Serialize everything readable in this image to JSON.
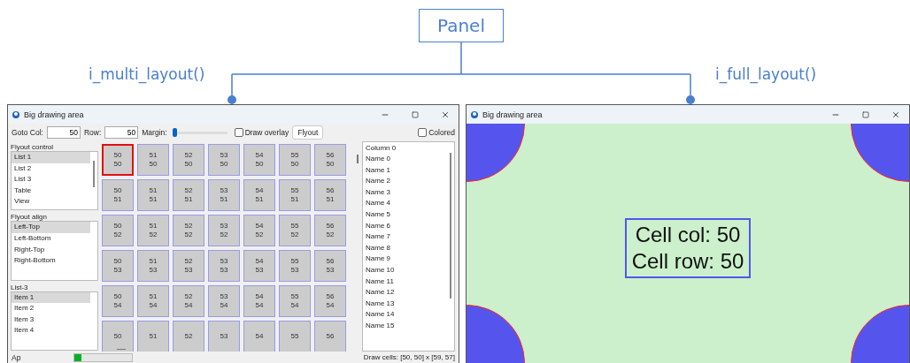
{
  "diagram": {
    "root": "Panel",
    "branches": [
      {
        "label": "i_multi_layout()"
      },
      {
        "label": "i_full_layout()"
      }
    ]
  },
  "multi_window": {
    "title": "Big drawing area",
    "goto_col_label": "Goto Col:",
    "goto_col": "50",
    "row_label": "Row:",
    "row": "50",
    "margin_label": "Margin:",
    "margin": {
      "level": 0
    },
    "draw_overlay": {
      "label": "Draw overlay",
      "checked": false
    },
    "flyout_button": "Flyout",
    "colored": {
      "label": "Colored",
      "checked": false
    },
    "lists": [
      {
        "title": "Flyout control",
        "items": [
          {
            "label": "List 1",
            "selected": true
          },
          {
            "label": "List 2",
            "selected": false
          },
          {
            "label": "List 3",
            "selected": false
          },
          {
            "label": "Table",
            "selected": false
          },
          {
            "label": "View",
            "selected": false
          }
        ]
      },
      {
        "title": "Flyout align",
        "items": [
          {
            "label": "Left-Top",
            "selected": true
          },
          {
            "label": "Left-Bottom",
            "selected": false
          },
          {
            "label": "Right-Top",
            "selected": false
          },
          {
            "label": "Right-Bottom",
            "selected": false
          }
        ]
      },
      {
        "title": "List-3",
        "items": [
          {
            "label": "Item 1",
            "selected": true
          },
          {
            "label": "Item 2",
            "selected": false
          },
          {
            "label": "Item 3",
            "selected": false
          },
          {
            "label": "Item 4",
            "selected": false
          }
        ]
      }
    ],
    "grid_rows": [
      {
        "cells": [
          {
            "col": "50",
            "row": "50",
            "selected": true
          },
          {
            "col": "51",
            "row": "50",
            "selected": false
          },
          {
            "col": "52",
            "row": "50",
            "selected": false
          },
          {
            "col": "53",
            "row": "50",
            "selected": false
          },
          {
            "col": "54",
            "row": "50",
            "selected": false
          },
          {
            "col": "55",
            "row": "50",
            "selected": false
          },
          {
            "col": "56",
            "row": "50",
            "selected": false
          }
        ]
      },
      {
        "cells": [
          {
            "col": "50",
            "row": "51",
            "selected": false
          },
          {
            "col": "51",
            "row": "51",
            "selected": false
          },
          {
            "col": "52",
            "row": "51",
            "selected": false
          },
          {
            "col": "53",
            "row": "51",
            "selected": false
          },
          {
            "col": "54",
            "row": "51",
            "selected": false
          },
          {
            "col": "55",
            "row": "51",
            "selected": false
          },
          {
            "col": "56",
            "row": "51",
            "selected": false
          }
        ]
      },
      {
        "cells": [
          {
            "col": "50",
            "row": "52",
            "selected": false
          },
          {
            "col": "51",
            "row": "52",
            "selected": false
          },
          {
            "col": "52",
            "row": "52",
            "selected": false
          },
          {
            "col": "53",
            "row": "52",
            "selected": false
          },
          {
            "col": "54",
            "row": "52",
            "selected": false
          },
          {
            "col": "55",
            "row": "52",
            "selected": false
          },
          {
            "col": "56",
            "row": "52",
            "selected": false
          }
        ]
      },
      {
        "cells": [
          {
            "col": "50",
            "row": "53",
            "selected": false
          },
          {
            "col": "51",
            "row": "53",
            "selected": false
          },
          {
            "col": "52",
            "row": "53",
            "selected": false
          },
          {
            "col": "53",
            "row": "53",
            "selected": false
          },
          {
            "col": "54",
            "row": "53",
            "selected": false
          },
          {
            "col": "55",
            "row": "53",
            "selected": false
          },
          {
            "col": "56",
            "row": "53",
            "selected": false
          }
        ]
      },
      {
        "cells": [
          {
            "col": "50",
            "row": "54",
            "selected": false
          },
          {
            "col": "51",
            "row": "54",
            "selected": false
          },
          {
            "col": "52",
            "row": "54",
            "selected": false
          },
          {
            "col": "53",
            "row": "54",
            "selected": false
          },
          {
            "col": "54",
            "row": "54",
            "selected": false
          },
          {
            "col": "55",
            "row": "54",
            "selected": false
          },
          {
            "col": "56",
            "row": "54",
            "selected": false
          }
        ]
      },
      {
        "cells": [
          {
            "col": "50",
            "selected": false
          },
          {
            "col": "51",
            "selected": false
          },
          {
            "col": "52",
            "selected": false
          },
          {
            "col": "53",
            "selected": false
          },
          {
            "col": "54",
            "selected": false
          },
          {
            "col": "55",
            "selected": false
          },
          {
            "col": "56",
            "selected": false
          }
        ]
      }
    ],
    "table": {
      "column": "Column 0",
      "rows": [
        "Name 0",
        "Name 1",
        "Name 2",
        "Name 3",
        "Name 4",
        "Name 5",
        "Name 6",
        "Name 7",
        "Name 8",
        "Name 9",
        "Name 10",
        "Name 11",
        "Name 12",
        "Name 13",
        "Name 14",
        "Name 15"
      ]
    },
    "status": {
      "label": "Ap",
      "progress": {
        "level": 0.12
      },
      "text": "Draw cells: [50, 50] x [59, 57]"
    }
  },
  "full_window": {
    "title": "Big drawing area",
    "cell_col": "Cell col: 50",
    "cell_row": "Cell row: 50"
  }
}
